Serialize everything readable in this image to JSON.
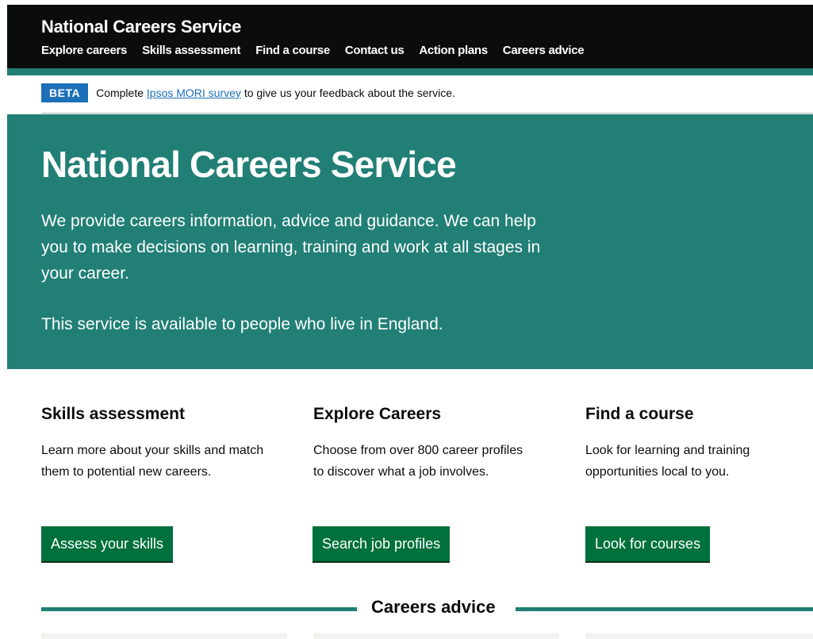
{
  "header": {
    "title": "National Careers Service",
    "nav": [
      "Explore careers",
      "Skills assessment",
      "Find a course",
      "Contact us",
      "Action plans",
      "Careers advice"
    ]
  },
  "beta": {
    "tag": "BETA",
    "before": "Complete",
    "link": "Ipsos MORI survey",
    "after": "to give us your feedback about the service."
  },
  "hero": {
    "title": "National Careers Service",
    "p1": "We provide careers information, advice and guidance. We can help you to make decisions on learning, training and work at all stages in your career.",
    "p2": "This service is available to people who live in England."
  },
  "cards": [
    {
      "title": "Skills assessment",
      "text": "Learn more about your skills and match them to potential new careers.",
      "button": "Assess your skills"
    },
    {
      "title": "Explore Careers",
      "text": "Choose from over 800 career profiles to discover what a job involves.",
      "button": "Search job profiles"
    },
    {
      "title": "Find a course",
      "text": "Look for learning and training opportunities local to you.",
      "button": "Look for courses"
    }
  ],
  "section": {
    "title": "Careers advice"
  },
  "colors": {
    "header": "#0b0c0c",
    "teal": "#217f76",
    "button": "#00703c",
    "beta": "#1d70b8"
  }
}
